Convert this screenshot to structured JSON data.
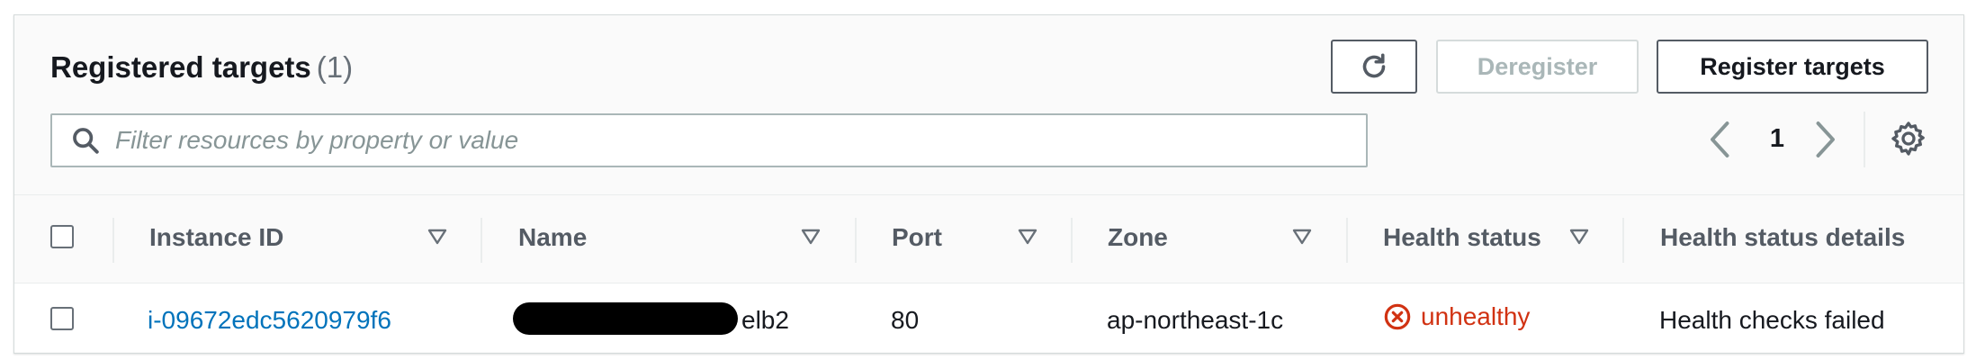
{
  "header": {
    "title": "Registered targets",
    "count": "(1)"
  },
  "toolbar": {
    "refresh_icon": "refresh-icon",
    "deregister_label": "Deregister",
    "register_label": "Register targets"
  },
  "filter": {
    "placeholder": "Filter resources by property or value",
    "value": ""
  },
  "pagination": {
    "current_page": "1"
  },
  "table": {
    "columns": [
      "Instance ID",
      "Name",
      "Port",
      "Zone",
      "Health status",
      "Health status details"
    ],
    "rows": [
      {
        "instance_id": "i-09672edc5620979f6",
        "name_visible_suffix": "elb2",
        "port": "80",
        "zone": "ap-northeast-1c",
        "health_status": "unhealthy",
        "health_status_details": "Health checks failed"
      }
    ]
  },
  "colors": {
    "link": "#0073bb",
    "error": "#d13212",
    "border": "#aab7b8"
  }
}
